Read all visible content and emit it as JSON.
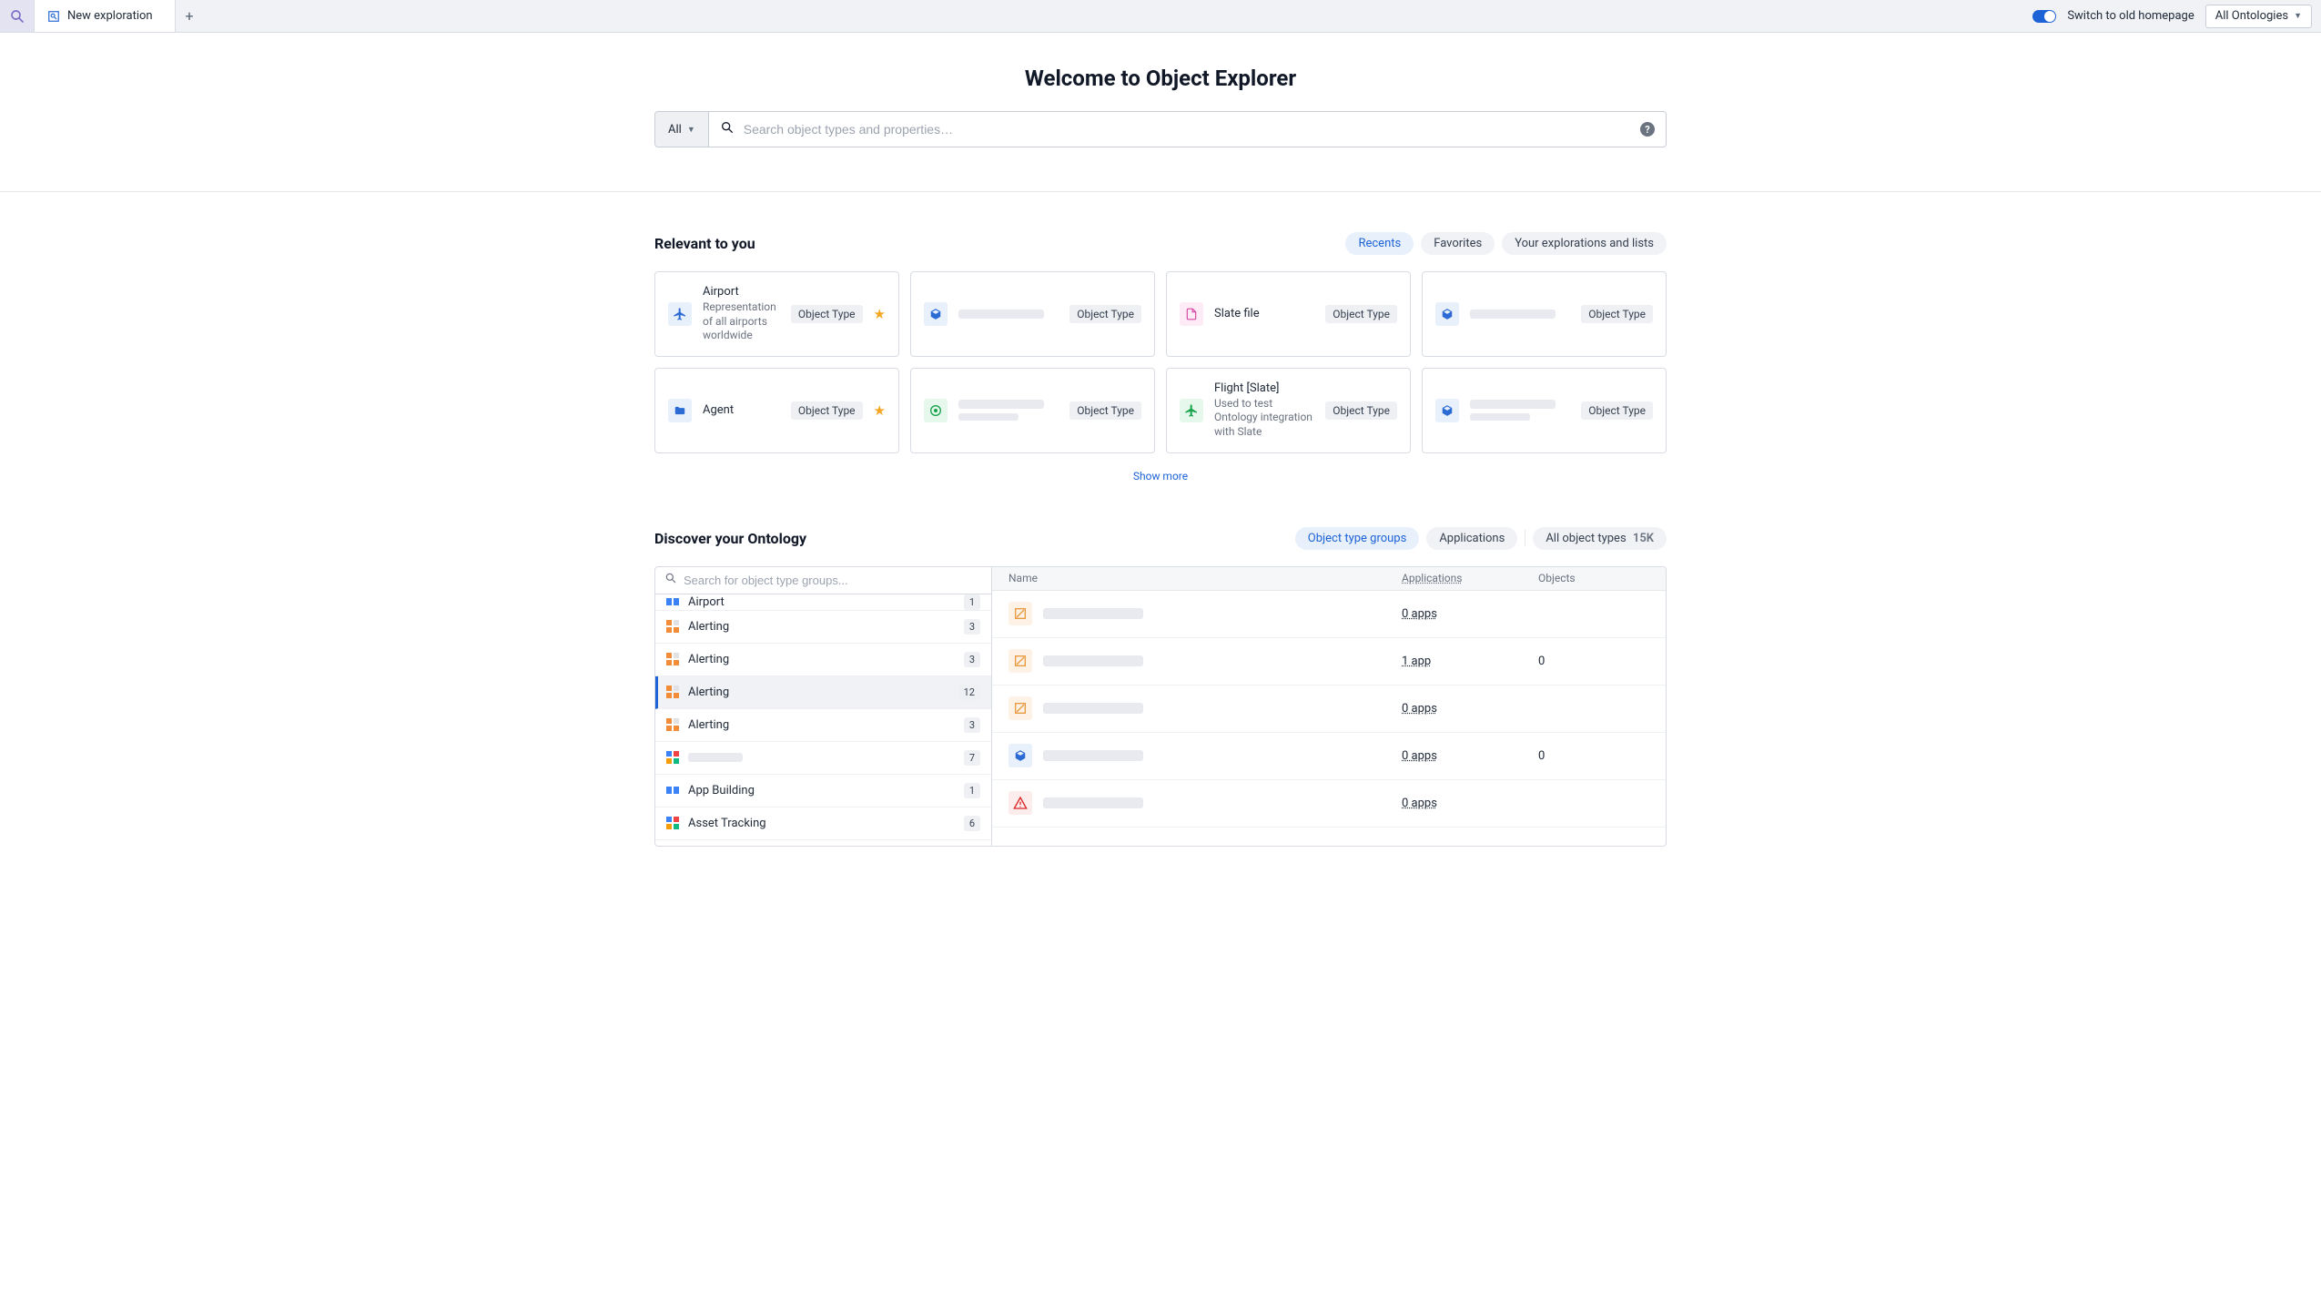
{
  "topbar": {
    "tab_label": "New exploration",
    "switch_label": "Switch to old homepage",
    "ontologies_label": "All Ontologies"
  },
  "page_title": "Welcome to Object Explorer",
  "search": {
    "scope": "All",
    "placeholder": "Search object types and properties…"
  },
  "relevant": {
    "title": "Relevant to you",
    "tabs": {
      "recents": "Recents",
      "favorites": "Favorites",
      "explorations": "Your explorations and lists"
    },
    "object_type_badge": "Object Type",
    "show_more": "Show more",
    "cards": {
      "airport": {
        "title": "Airport",
        "desc": "Representation of all airports worldwide"
      },
      "slate": {
        "title": "Slate file"
      },
      "agent": {
        "title": "Agent"
      },
      "flight": {
        "title": "Flight [Slate]",
        "desc": "Used to test Ontology integration with Slate"
      }
    }
  },
  "discover": {
    "title": "Discover your Ontology",
    "tabs": {
      "groups": "Object type groups",
      "apps": "Applications",
      "all_label": "All object types",
      "all_count": "15K"
    },
    "search_placeholder": "Search for object type groups...",
    "headers": {
      "name": "Name",
      "apps": "Applications",
      "objects": "Objects"
    },
    "groups": [
      {
        "name": "Airport",
        "count": "1",
        "type": "blue",
        "partial": true
      },
      {
        "name": "Alerting",
        "count": "3",
        "type": "alert"
      },
      {
        "name": "Alerting",
        "count": "3",
        "type": "alert"
      },
      {
        "name": "Alerting",
        "count": "12",
        "type": "alert",
        "active": true
      },
      {
        "name": "Alerting",
        "count": "3",
        "type": "alert"
      },
      {
        "name": "",
        "count": "7",
        "type": "multi",
        "blurred": true
      },
      {
        "name": "App Building",
        "count": "1",
        "type": "blue"
      },
      {
        "name": "Asset Tracking",
        "count": "6",
        "type": "multi"
      }
    ],
    "rows": [
      {
        "icon": "orange-slash",
        "apps": "0 apps",
        "objects": ""
      },
      {
        "icon": "orange-slash",
        "apps": "1 app",
        "objects": "0",
        "underline": true
      },
      {
        "icon": "orange-slash",
        "apps": "0 apps",
        "objects": ""
      },
      {
        "icon": "blue-cube",
        "apps": "0 apps",
        "objects": "0"
      },
      {
        "icon": "red-warn",
        "apps": "0 apps",
        "objects": ""
      }
    ]
  }
}
